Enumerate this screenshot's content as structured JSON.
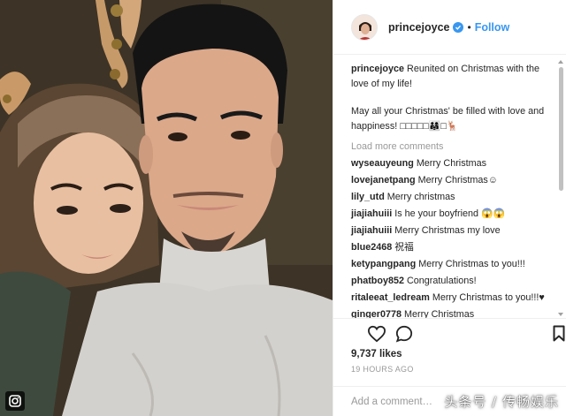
{
  "post": {
    "username": "princejoyce",
    "follow_label": "Follow",
    "separator": "•"
  },
  "caption": {
    "username": "princejoyce",
    "line1": "Reunited on Christmas with the love of my life!",
    "line2": "May all your Christmas' be filled with love and happiness! □□□□□👨‍👩‍👧□🦌"
  },
  "load_more_label": "Load more comments",
  "comments": [
    {
      "user": "wyseauyeung",
      "text": "Merry Christmas"
    },
    {
      "user": "lovejanetpang",
      "text": "Merry Christmas☺"
    },
    {
      "user": "lily_utd",
      "text": "Merry christmas"
    },
    {
      "user": "jiajiahuiii",
      "text": "Is he your boyfriend 😱😱"
    },
    {
      "user": "jiajiahuiii",
      "text": "Merry Christmas my love"
    },
    {
      "user": "blue2468",
      "text": "祝福"
    },
    {
      "user": "ketypangpang",
      "text": "Merry Christmas to you!!!"
    },
    {
      "user": "phatboy852",
      "text": "Congratulations!"
    },
    {
      "user": "ritaleeat_ledream",
      "text": "Merry Christmas to you!!!♥"
    },
    {
      "user": "ginger0778",
      "text": "Merry Christmas"
    }
  ],
  "likes": "9,737 likes",
  "time": "19 HOURS AGO",
  "add_comment_placeholder": "Add a comment…",
  "watermark": "头条号 / 传畅娱乐",
  "icons": {
    "like": "heart-icon",
    "comment": "comment-icon",
    "save": "bookmark-icon",
    "verified": "verified-badge-icon",
    "photo_corner": "instagram-icon"
  },
  "colors": {
    "link_blue": "#3897f0",
    "muted_gray": "#999999",
    "text": "#262626"
  }
}
